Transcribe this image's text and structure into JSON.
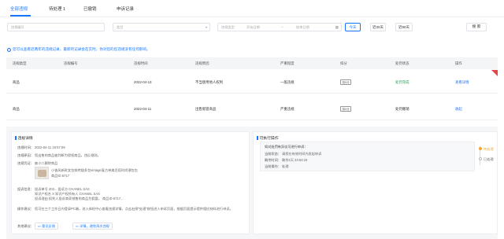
{
  "tabs": {
    "items": [
      "全部违规",
      "待处理 1",
      "已撤销",
      "申诉记录"
    ]
  },
  "filters": {
    "id_placeholder": "违规编号",
    "category_placeholder": "类目",
    "type_placeholder": "违规类型",
    "start_placeholder": "开始日期",
    "arrow": "~",
    "end_placeholder": "结束日期",
    "ranges": [
      "今天",
      "近30天",
      "近90天"
    ],
    "search": "搜 索"
  },
  "notice": "您可以查看近两年的违规记录，最新的记录会在实时，你对您的您违规没有任何影响。",
  "table": {
    "headers": [
      "违规类型",
      "违规编号",
      "违规时间",
      "违规原因",
      "严重程度",
      "扣分",
      "处罚状态",
      "操作"
    ],
    "rows": [
      {
        "type": "商品",
        "id": "",
        "time": "2022-04-13",
        "reason": "不当使用他人权利",
        "severity": "一般违规",
        "points": "扣0分",
        "status": "处罚完成",
        "action": "查看详情"
      },
      {
        "type": "商品",
        "id": "",
        "time": "2022-04-11",
        "reason": "出售假冒商品",
        "severity": "严重违规",
        "points": "扣0分",
        "status": "处罚撤销",
        "action": "收起"
      }
    ]
  },
  "detail": {
    "title": "违规详情",
    "time_label": "违规时间：",
    "time_value": "2022-04-11 19:57:09",
    "desc_label": "违规原因：",
    "desc_value": "您出售的商品被判断为侵权商品，违反规则。",
    "evidence_label": "违规凭证：",
    "evidence_value": "被小二删除商品",
    "product_link": "小香风新款女包斜挎链条包vintage复古单肩百搭时尚潮包包",
    "product_id": "商品ID:6717",
    "complaint_label": "投诉信息：",
    "complaint_lines": [
      "投诉单号 202...                          投诉方 CHANEL SAS",
      "知识产权名 X 知识产权所有人 CHANEL SAS",
      "投诉理由 权利人投诉商家销售的商品为假冒。 商品ID 6717..."
    ],
    "advice_label": "操作建议：",
    "advice_value": "您可在三个工作日内登录PC端，进入体检中心查看违规详情，点击右侧\"处理\"按钮进入申诉页面，根据页面提示提供相应材料进行申诉。",
    "other_label": "其他建议：",
    "btn_feedback": "意见反馈",
    "btn_learn": "详情，避免再次违规"
  },
  "execute": {
    "title": "可执行操作",
    "step_title": "如对处罚有异议可进行申诉：",
    "status_label": "当前状态：",
    "status_value": "请您在有效时间内发起申诉",
    "remain_label": "剩余时间：",
    "remain_value": "剩余4天 23:54:23",
    "action_label": "当前操作：",
    "action_value": "处理",
    "side1": "待处理",
    "side2": "已处理"
  },
  "colors": {
    "accent": "#1677ff",
    "ok": "#22a35a",
    "warn": "#f5a623",
    "flag": "#e54545"
  }
}
